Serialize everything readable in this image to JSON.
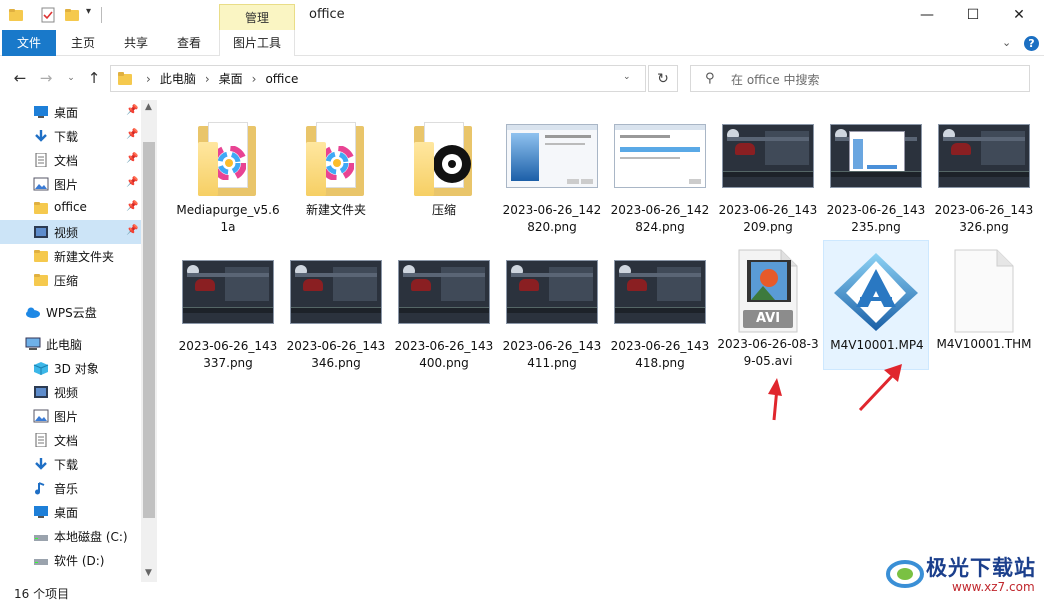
{
  "window": {
    "title": "office",
    "manage_tab": "管理",
    "minimize": "—",
    "maximize": "☐",
    "close": "✕"
  },
  "ribbon": {
    "tabs": [
      "文件",
      "主页",
      "共享",
      "查看",
      "图片工具"
    ],
    "expand": "⌄",
    "help": "?"
  },
  "address": {
    "crumbs": [
      "此电脑",
      "桌面",
      "office"
    ],
    "search_placeholder": "在 office 中搜索"
  },
  "sidebar": {
    "quick_access": [
      {
        "label": "桌面",
        "icon": "desktop-icon",
        "pinned": true
      },
      {
        "label": "下载",
        "icon": "download-icon",
        "pinned": true
      },
      {
        "label": "文档",
        "icon": "document-icon",
        "pinned": true
      },
      {
        "label": "图片",
        "icon": "picture-icon",
        "pinned": true
      },
      {
        "label": "office",
        "icon": "folder-icon",
        "pinned": true
      },
      {
        "label": "视频",
        "icon": "video-icon",
        "pinned": true,
        "selected": true
      },
      {
        "label": "新建文件夹",
        "icon": "folder-icon",
        "pinned": false
      },
      {
        "label": "压缩",
        "icon": "folder-icon",
        "pinned": false
      }
    ],
    "wps": "WPS云盘",
    "this_pc": "此电脑",
    "pc_items": [
      {
        "label": "3D 对象",
        "icon": "3d-objects-icon"
      },
      {
        "label": "视频",
        "icon": "video-icon"
      },
      {
        "label": "图片",
        "icon": "picture-icon"
      },
      {
        "label": "文档",
        "icon": "document-icon"
      },
      {
        "label": "下载",
        "icon": "download-icon"
      },
      {
        "label": "音乐",
        "icon": "music-icon"
      },
      {
        "label": "桌面",
        "icon": "desktop-icon"
      },
      {
        "label": "本地磁盘 (C:)",
        "icon": "drive-icon"
      },
      {
        "label": "软件 (D:)",
        "icon": "drive-icon"
      }
    ]
  },
  "files": [
    {
      "name": "Mediapurge_v5.61a",
      "kind": "folder-app"
    },
    {
      "name": "新建文件夹",
      "kind": "folder-app"
    },
    {
      "name": "压缩",
      "kind": "folder-disc"
    },
    {
      "name": "2023-06-26_142820.png",
      "kind": "shot-light"
    },
    {
      "name": "2023-06-26_142824.png",
      "kind": "shot-white"
    },
    {
      "name": "2023-06-26_143209.png",
      "kind": "shot-dark"
    },
    {
      "name": "2023-06-26_143235.png",
      "kind": "shot-dialog"
    },
    {
      "name": "2023-06-26_143326.png",
      "kind": "shot-dark"
    },
    {
      "name": "2023-06-26_143337.png",
      "kind": "shot-dark"
    },
    {
      "name": "2023-06-26_143346.png",
      "kind": "shot-dark"
    },
    {
      "name": "2023-06-26_143400.png",
      "kind": "shot-dark"
    },
    {
      "name": "2023-06-26_143411.png",
      "kind": "shot-dark"
    },
    {
      "name": "2023-06-26_143418.png",
      "kind": "shot-dark"
    },
    {
      "name": "2023-06-26-08-39-05.avi",
      "kind": "avi",
      "badge": "AVI"
    },
    {
      "name": "M4V10001.MP4",
      "kind": "mp4",
      "selected": true
    },
    {
      "name": "M4V10001.THM",
      "kind": "blank"
    }
  ],
  "status": {
    "count": "16 个项目"
  },
  "watermark": {
    "name": "极光下载站",
    "url": "www.xz7.com"
  },
  "colors": {
    "accent": "#1979ca",
    "selection": "#cce4f7",
    "arrow": "#e0262d"
  }
}
